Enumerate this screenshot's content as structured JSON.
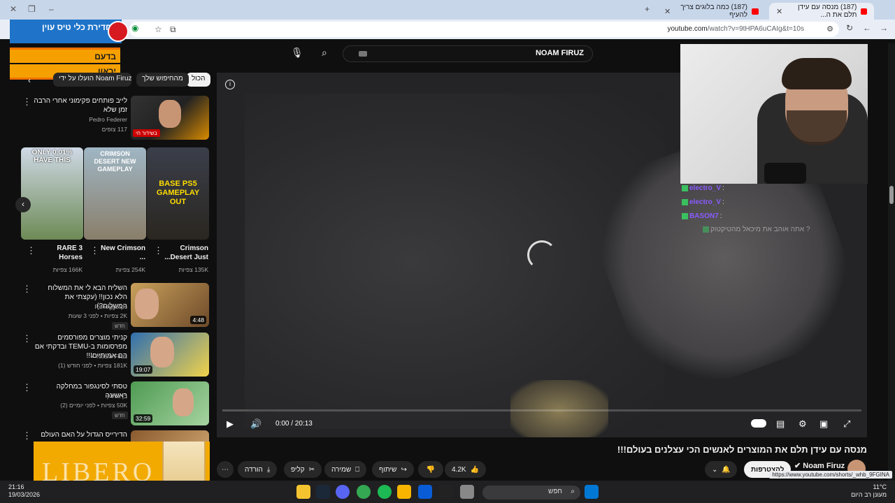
{
  "browser": {
    "tabs": [
      {
        "title": "(187) מנסה עם עידן תלם את ה..."
      },
      {
        "title": "(187) כמה בלוגים צריך להעיף"
      }
    ],
    "url_host": "youtube.com",
    "url_path": "/watch?v=9tHPA6uCAIg&t=10s",
    "hover_url": "https://www.youtube.com/shorts/_whb_9FGINA"
  },
  "overlays": {
    "badge_text": "חדירת כלי טיס עוין",
    "strip1": "בדעם",
    "strip2": "יראון",
    "ad_text": "LIBERO"
  },
  "search": {
    "query": "NOAM FIRUZ"
  },
  "chips": [
    "הכול",
    "מהחיפוש שלך",
    "הועלו על ידי Noam Firuz"
  ],
  "sidebar": {
    "live": {
      "title": "לייב פותחים פקימוני אחרי הרבה זמן שלא",
      "channel": "Pedro Federer",
      "views": "117 צופים",
      "live_label": "בשידור חי"
    },
    "shorts": [
      {
        "title": "Crimson Desert Just...",
        "views": "135K צפיות",
        "thumb_text": "BASE PS5 GAMEPLAY OUT"
      },
      {
        "title": "New Crimson ...",
        "views": "254K צפיות",
        "thumb_text": "CRIMSON DESERT NEW GAMEPLAY"
      },
      {
        "title": "3 RARE Horses",
        "views": "166K צפיות",
        "thumb_text": "ONLY 0.01% HAVE THIS"
      }
    ],
    "videos": [
      {
        "title": "השליח הבא לי את המשלוח הלא נכון!! (עקצתי את המשלוח?)",
        "channel": "Roneggclips",
        "meta": "2K צפיות • לפני 3 שעות",
        "badge": "חדש",
        "duration": "4:48"
      },
      {
        "title": "קניתי מוצרים מפורסמים מפרסומות ב-TEMU ובדקתי אם הם אמיתיים!!!",
        "channel": "Noam Firuz",
        "meta": "181K צפיות • לפני חודש (1)",
        "badge": "",
        "duration": "19:07"
      },
      {
        "title": "טסתי לסינגפור במחלקה ראשונה",
        "channel": "בן גורדין",
        "meta": "50K צפיות • לפני יומיים (2)",
        "badge": "חדש",
        "duration": "32:59"
      },
      {
        "title": "הדירייס הגדול על האם העולם הוא...",
        "channel": "",
        "meta": "",
        "badge": "",
        "duration": ""
      }
    ]
  },
  "player": {
    "time": "0:00 / 20:13",
    "progress_fraction": 0.04
  },
  "chat": [
    {
      "user": "electro_V",
      "text": ":"
    },
    {
      "user": "electro_V",
      "text": ":"
    },
    {
      "user": "BASON7",
      "text": ":"
    },
    {
      "user": "",
      "text": "אתה אוהב את מיכאל מהטיקטוק ?"
    }
  ],
  "video": {
    "title": "מנסה עם עידן תלם את המוצרים לאנשים הכי עצלנים בעולם!!!",
    "channel": "Noam Firuz",
    "subscribe": "להצטרפות",
    "likes": "4.2K",
    "share": "שיתוף",
    "save": "שמירה",
    "clip": "קליפ",
    "download": "הורדה"
  },
  "taskbar": {
    "time": "21:16",
    "date": "19/03/2026",
    "search": "חפש",
    "weather_temp": "11°C",
    "weather_desc": "מעונן רב היום"
  },
  "colors": {
    "yt_red": "#ff0000",
    "chat_name": "#8a5cff",
    "badge_blue": "#1f74c9",
    "strip_orange": "#f6a000"
  }
}
